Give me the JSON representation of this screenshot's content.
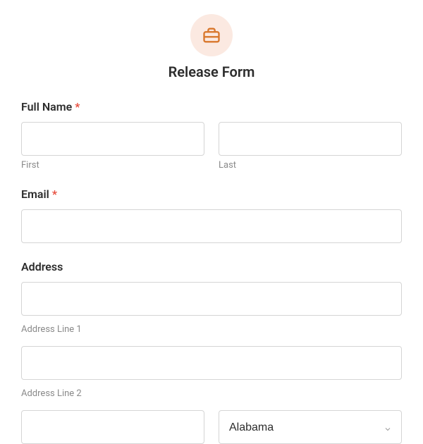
{
  "header": {
    "title": "Release Form"
  },
  "fields": {
    "fullName": {
      "label": "Full Name",
      "required": "*",
      "first": {
        "sublabel": "First"
      },
      "last": {
        "sublabel": "Last"
      }
    },
    "email": {
      "label": "Email",
      "required": "*"
    },
    "address": {
      "label": "Address",
      "line1": {
        "sublabel": "Address Line 1"
      },
      "line2": {
        "sublabel": "Address Line 2"
      },
      "state": {
        "selected": "Alabama"
      }
    }
  }
}
